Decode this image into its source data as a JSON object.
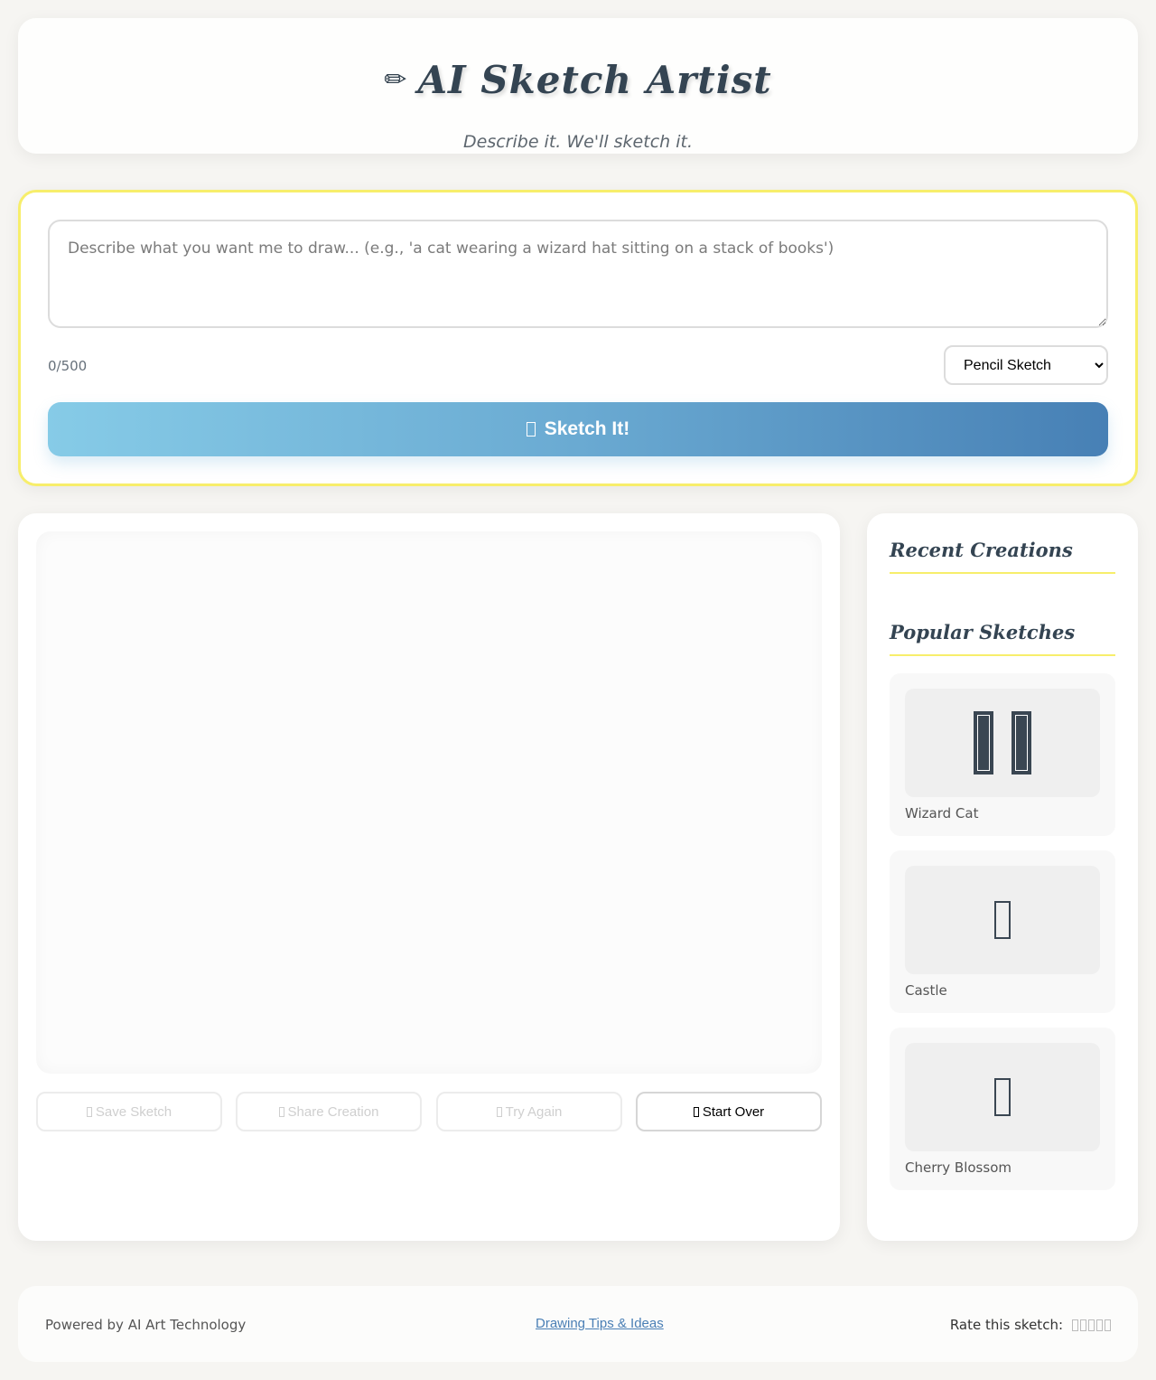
{
  "header": {
    "icon": "pencil-icon",
    "pencil_glyph": "✏",
    "title": "AI Sketch Artist",
    "subtitle": "Describe it. We'll sketch it."
  },
  "input": {
    "placeholder": "Describe what you want me to draw... (e.g., 'a cat wearing a wizard hat sitting on a stack of books')",
    "char_count": "0/500",
    "style_selected": "Pencil Sketch",
    "sketch_button": "Sketch It!",
    "accent_border": "#f7ee6b",
    "button_gradient": [
      "#86cbe7",
      "#4780b5"
    ]
  },
  "actions": {
    "save": "Save Sketch",
    "share": "Share Creation",
    "try_again": "Try Again",
    "start_over": "Start Over"
  },
  "sidebar": {
    "recent_heading": "Recent Creations",
    "popular_heading": "Popular Sketches",
    "popular": [
      {
        "name": "Wizard Cat",
        "icon": "wizard-cat-icon"
      },
      {
        "name": "Castle",
        "icon": "castle-icon"
      },
      {
        "name": "Cherry Blossom",
        "icon": "cherry-blossom-icon"
      }
    ]
  },
  "footer": {
    "powered": "Powered by AI Art Technology",
    "tips_link": "Drawing Tips & Ideas",
    "rate_label": "Rate this sketch:",
    "star_count": 5
  }
}
